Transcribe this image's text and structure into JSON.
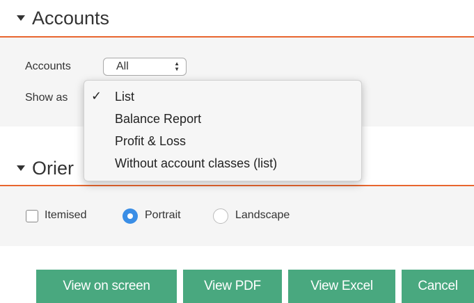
{
  "accounts_section": {
    "title": "Accounts",
    "accounts_label": "Accounts",
    "accounts_value": "All",
    "show_as_label": "Show as",
    "dropdown_options": [
      {
        "label": "List",
        "checked": true
      },
      {
        "label": "Balance Report",
        "checked": false
      },
      {
        "label": "Profit & Loss",
        "checked": false
      },
      {
        "label": "Without account classes (list)",
        "checked": false
      }
    ],
    "check_mark": "✓"
  },
  "orientation_section": {
    "title_visible": "Orier",
    "itemised_label": "Itemised",
    "portrait_label": "Portrait",
    "landscape_label": "Landscape",
    "selected": "Portrait"
  },
  "buttons": {
    "view_on_screen": "View on screen",
    "view_pdf": "View PDF",
    "view_excel": "View Excel",
    "cancel": "Cancel"
  },
  "colors": {
    "accent_rule": "#e8662e",
    "button": "#49a87f",
    "radio_selected": "#3a8ee6"
  }
}
